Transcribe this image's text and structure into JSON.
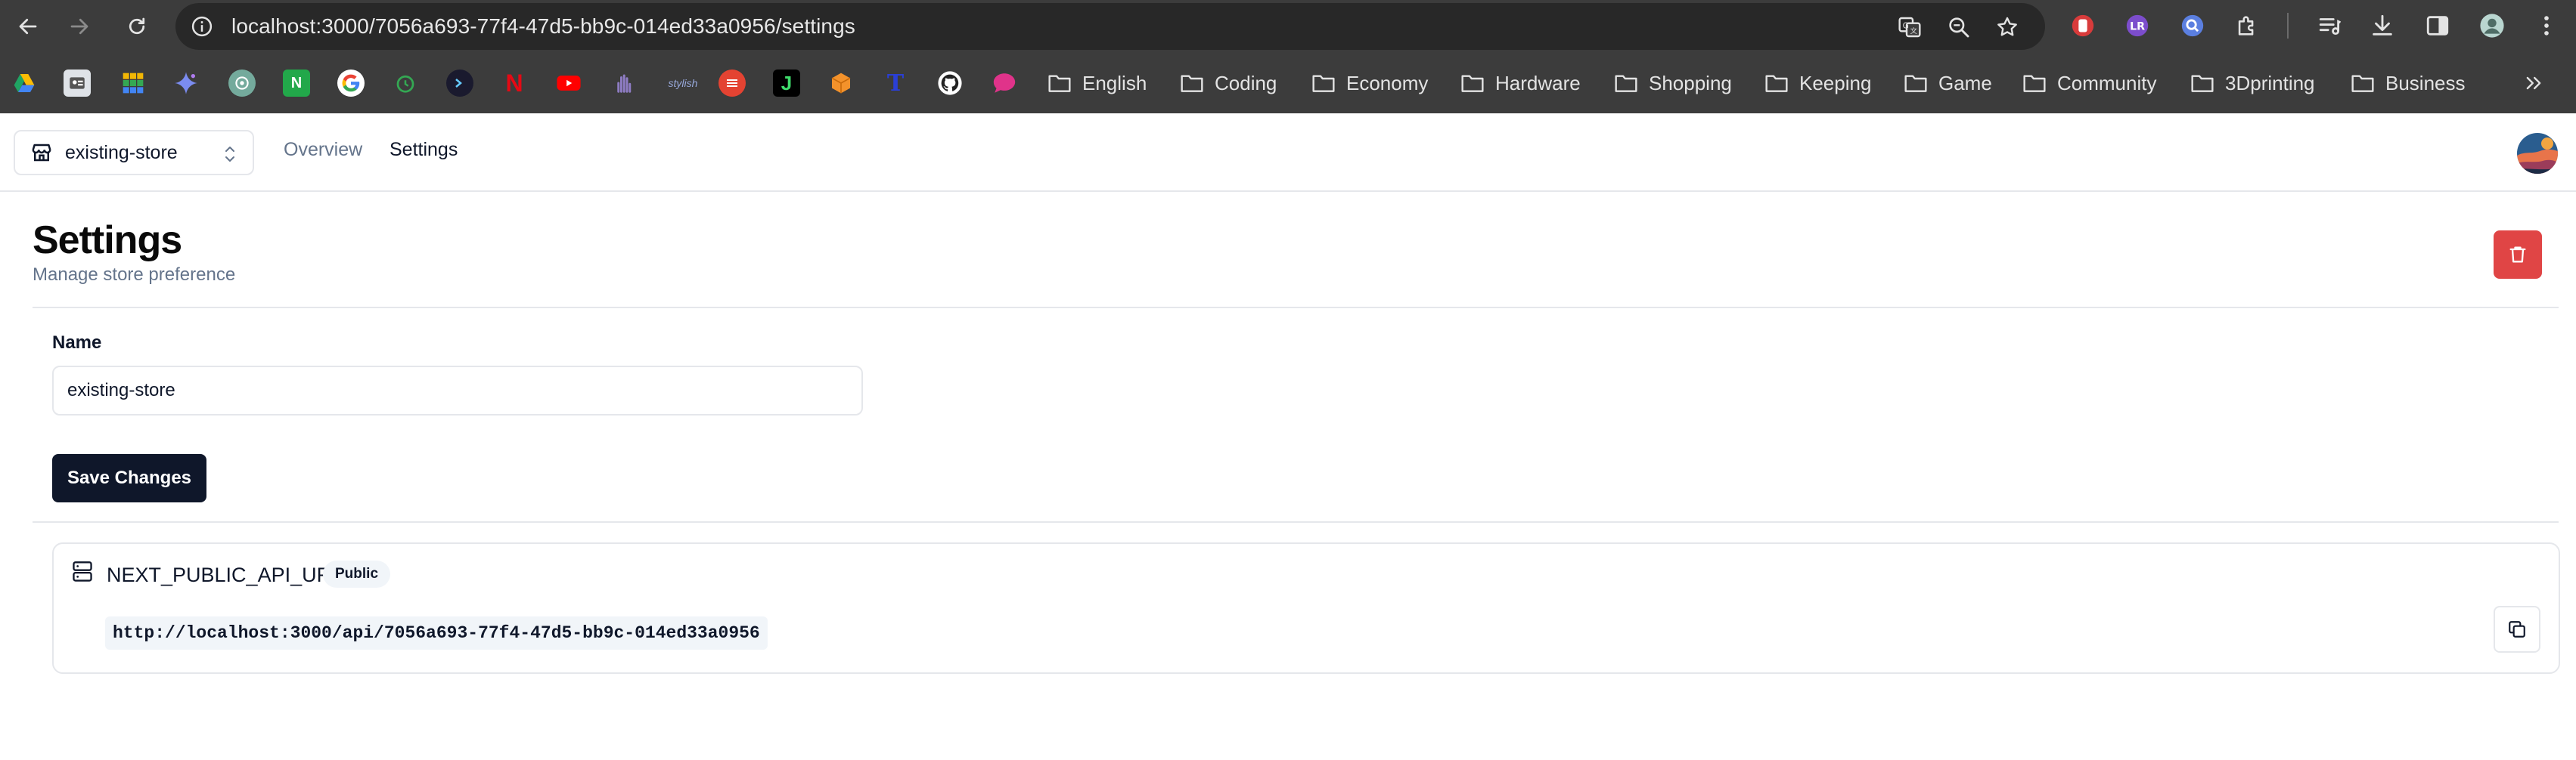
{
  "browser": {
    "url": "localhost:3000/7056a693-77f4-47d5-bb9c-014ed33a0956/settings",
    "bookmark_folders": [
      "English",
      "Coding",
      "Economy",
      "Hardware",
      "Shopping",
      "Keeping",
      "Game",
      "Community",
      "3Dprinting",
      "Business"
    ],
    "bookmark_icons": [
      "google-drive-icon",
      "contacts-icon",
      "sheets-icon",
      "gemini-icon",
      "chatgpt-icon",
      "notion-icon",
      "google-icon",
      "timer-icon",
      "terminal-icon",
      "netflix-icon",
      "youtube-icon",
      "hand-icon",
      "stylus-icon",
      "todoist-icon",
      "j-icon",
      "box-icon",
      "t-icon",
      "github-icon",
      "chat-bubble-icon"
    ]
  },
  "app": {
    "store_switcher": {
      "name": "existing-store"
    },
    "nav": {
      "overview": "Overview",
      "settings": "Settings"
    }
  },
  "page": {
    "title": "Settings",
    "subtitle": "Manage store preference"
  },
  "form": {
    "name_label": "Name",
    "name_value": "existing-store",
    "save_label": "Save Changes"
  },
  "api": {
    "name": "NEXT_PUBLIC_API_URL",
    "badge": "Public",
    "url": "http://localhost:3000/api/7056a693-77f4-47d5-bb9c-014ed33a0956"
  },
  "colors": {
    "chrome_bg": "#3c3c3c",
    "omnibox_bg": "#282828",
    "primary": "#0f172a",
    "destructive": "#e04545",
    "muted_text": "#64748b",
    "border": "#e5e7eb"
  }
}
